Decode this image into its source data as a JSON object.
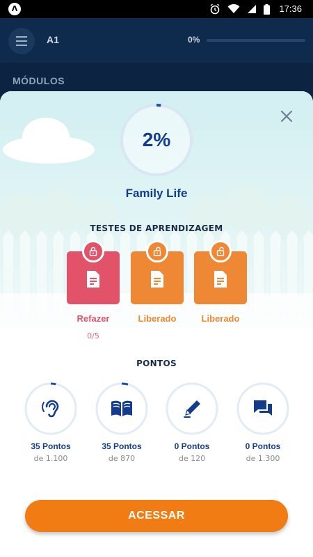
{
  "status_bar": {
    "time": "17:36",
    "icons": [
      "alarm-icon",
      "wifi-icon",
      "signal-icon",
      "battery-icon"
    ]
  },
  "app_bar": {
    "level": "A1",
    "progress_label": "0%",
    "progress": 0
  },
  "section_title": "MÓDULOS",
  "module": {
    "percent_label": "2%",
    "percent": 2,
    "title": "Family Life"
  },
  "tests": {
    "title": "TESTES DE APRENDIZAGEM",
    "items": [
      {
        "label": "Refazer",
        "sub": "0/5",
        "state": "locked",
        "color": "#e2536a"
      },
      {
        "label": "Liberado",
        "sub": "",
        "state": "unlocked",
        "color": "#ef8834"
      },
      {
        "label": "Liberado",
        "sub": "",
        "state": "unlocked",
        "color": "#ef8834"
      }
    ]
  },
  "points": {
    "title": "PONTOS",
    "items": [
      {
        "icon": "ear-icon",
        "label": "35 Pontos",
        "sub": "de 1.100",
        "fraction": 0.032
      },
      {
        "icon": "book-icon",
        "label": "35 Pontos",
        "sub": "de 870",
        "fraction": 0.04
      },
      {
        "icon": "pencil-icon",
        "label": "0 Pontos",
        "sub": "de 120",
        "fraction": 0
      },
      {
        "icon": "chat-icon",
        "label": "0 Pontos",
        "sub": "de 1.300",
        "fraction": 0
      }
    ]
  },
  "cta_label": "ACESSAR",
  "colors": {
    "primary": "#133d8c",
    "accent": "#f07c13",
    "ring_track": "#e3ebf6",
    "ring_fill": "#1d4fb0"
  }
}
